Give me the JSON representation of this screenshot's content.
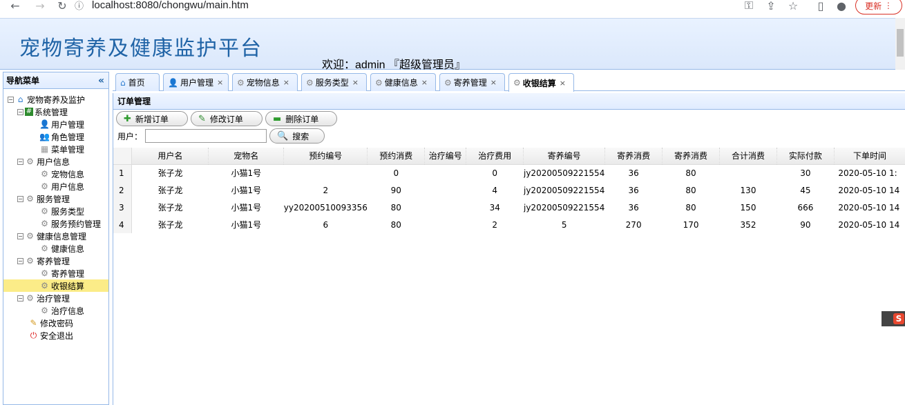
{
  "browser": {
    "url": "localhost:8080/chongwu/main.htm",
    "update_label": "更新"
  },
  "header": {
    "title": "宠物寄养及健康监护平台",
    "welcome": "欢迎：admin 『超级管理员』"
  },
  "sidebar": {
    "title": "导航菜单",
    "root": "宠物寄养及监护",
    "groups": [
      {
        "label": "系统管理",
        "items": [
          "用户管理",
          "角色管理",
          "菜单管理"
        ]
      },
      {
        "label": "用户信息",
        "items": [
          "宠物信息",
          "用户信息"
        ]
      },
      {
        "label": "服务管理",
        "items": [
          "服务类型",
          "服务预约管理"
        ]
      },
      {
        "label": "健康信息管理",
        "items": [
          "健康信息"
        ]
      },
      {
        "label": "寄养管理",
        "items": [
          "寄养管理",
          "收银结算"
        ]
      },
      {
        "label": "治疗管理",
        "items": [
          "治疗信息"
        ]
      }
    ],
    "change_password": "修改密码",
    "logout": "安全退出"
  },
  "tabs": [
    "首页",
    "用户管理",
    "宠物信息",
    "服务类型",
    "健康信息",
    "寄养管理",
    "收银结算"
  ],
  "panel": {
    "title": "订单管理",
    "add_label": "新增订单",
    "edit_label": "修改订单",
    "delete_label": "删除订单",
    "user_label": "用户：",
    "user_value": "",
    "search_label": "搜索"
  },
  "grid": {
    "columns": [
      "用户名",
      "宠物名",
      "预约编号",
      "预约消费",
      "治疗编号",
      "治疗费用",
      "寄养编号",
      "寄养消费",
      "寄养消费",
      "合计消费",
      "实际付款",
      "下单时间"
    ],
    "rows": [
      [
        "1",
        "张子龙",
        "小猫1号",
        "",
        "0",
        "",
        "0",
        "jy20200509221554",
        "36",
        "80",
        "",
        "30",
        "2020-05-10 1:"
      ],
      [
        "2",
        "张子龙",
        "小猫1号",
        "2",
        "90",
        "",
        "4",
        "jy20200509221554",
        "36",
        "80",
        "130",
        "45",
        "2020-05-10 14"
      ],
      [
        "3",
        "张子龙",
        "小猫1号",
        "yy20200510093356",
        "80",
        "",
        "34",
        "jy20200509221554",
        "36",
        "80",
        "150",
        "666",
        "2020-05-10 14"
      ],
      [
        "4",
        "张子龙",
        "小猫1号",
        "6",
        "80",
        "",
        "2",
        "5",
        "270",
        "170",
        "352",
        "90",
        "2020-05-10 14"
      ]
    ]
  }
}
